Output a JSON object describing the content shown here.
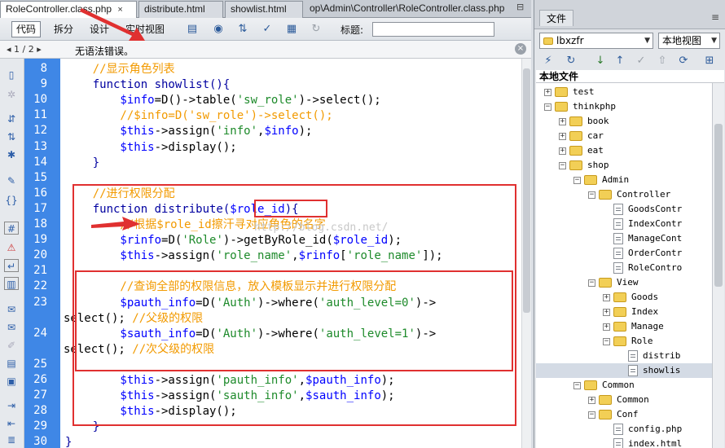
{
  "tabs": [
    {
      "label": "RoleController.class.php"
    },
    {
      "label": "distribute.html"
    },
    {
      "label": "showlist.html"
    },
    {
      "label": "op\\Admin\\Controller\\RoleController.class.php"
    }
  ],
  "tab_close": "×",
  "tab_restore": "⊟",
  "toolbar": {
    "code": "代码",
    "split": "拆分",
    "design": "设计",
    "live_view": "实时视图",
    "title_label": "标题:",
    "title_value": ""
  },
  "infobar": {
    "page_nav": "◂ 1 / 2 ▸",
    "status": "无语法错误。",
    "close": "×"
  },
  "watermark": "http://blog.csdn.net/",
  "code_lines": [
    {
      "n": "8",
      "parts": [
        {
          "t": "    //显示角色列表",
          "c": "cm"
        }
      ]
    },
    {
      "n": "9",
      "parts": [
        {
          "t": "    function showlist(){",
          "c": "kw"
        }
      ]
    },
    {
      "n": "10",
      "parts": [
        {
          "t": "        $info",
          "c": "vr"
        },
        {
          "t": "=D()->table(",
          "c": "op"
        },
        {
          "t": "'sw_role'",
          "c": "st"
        },
        {
          "t": ")->select();",
          "c": "op"
        }
      ]
    },
    {
      "n": "11",
      "parts": [
        {
          "t": "        //$info=D('sw_role')->select();",
          "c": "cm"
        }
      ]
    },
    {
      "n": "12",
      "parts": [
        {
          "t": "        $this",
          "c": "vr"
        },
        {
          "t": "->assign(",
          "c": "op"
        },
        {
          "t": "'info'",
          "c": "st"
        },
        {
          "t": ",",
          "c": "op"
        },
        {
          "t": "$info",
          "c": "vr"
        },
        {
          "t": ");",
          "c": "op"
        }
      ]
    },
    {
      "n": "13",
      "parts": [
        {
          "t": "        $this",
          "c": "vr"
        },
        {
          "t": "->display();",
          "c": "op"
        }
      ]
    },
    {
      "n": "14",
      "parts": [
        {
          "t": "    }",
          "c": "kw"
        }
      ]
    },
    {
      "n": "15",
      "parts": [
        {
          "t": "",
          "c": "op"
        }
      ]
    },
    {
      "n": "16",
      "parts": [
        {
          "t": "    //进行权限分配",
          "c": "cm"
        }
      ]
    },
    {
      "n": "17",
      "parts": [
        {
          "t": "    function distribute(",
          "c": "kw"
        },
        {
          "t": "$role_id",
          "c": "vr"
        },
        {
          "t": "){",
          "c": "kw"
        }
      ]
    },
    {
      "n": "18",
      "parts": [
        {
          "t": "        //根据$role_id擦汗寻对应角色的名字",
          "c": "cm"
        }
      ]
    },
    {
      "n": "19",
      "parts": [
        {
          "t": "        $rinfo",
          "c": "vr"
        },
        {
          "t": "=D(",
          "c": "op"
        },
        {
          "t": "'Role'",
          "c": "st"
        },
        {
          "t": ")->getByRole_id(",
          "c": "op"
        },
        {
          "t": "$role_id",
          "c": "vr"
        },
        {
          "t": ");",
          "c": "op"
        }
      ]
    },
    {
      "n": "20",
      "parts": [
        {
          "t": "        $this",
          "c": "vr"
        },
        {
          "t": "->assign(",
          "c": "op"
        },
        {
          "t": "'role_name'",
          "c": "st"
        },
        {
          "t": ",",
          "c": "op"
        },
        {
          "t": "$rinfo",
          "c": "vr"
        },
        {
          "t": "[",
          "c": "op"
        },
        {
          "t": "'role_name'",
          "c": "st"
        },
        {
          "t": "]);",
          "c": "op"
        }
      ]
    },
    {
      "n": "21",
      "parts": [
        {
          "t": "",
          "c": "op"
        }
      ]
    },
    {
      "n": "22",
      "parts": [
        {
          "t": "        //查询全部的权限信息，放入模板显示并进行权限分配",
          "c": "cm"
        }
      ]
    },
    {
      "n": "23",
      "parts": [
        {
          "t": "        $pauth_info",
          "c": "vr"
        },
        {
          "t": "=D(",
          "c": "op"
        },
        {
          "t": "'Auth'",
          "c": "st"
        },
        {
          "t": ")->where(",
          "c": "op"
        },
        {
          "t": "'auth_level=0'",
          "c": "st"
        },
        {
          "t": ")->",
          "c": "op"
        }
      ]
    },
    {
      "n": "",
      "parts": [
        {
          "t": "select(); ",
          "c": "op"
        },
        {
          "t": "//父级的权限",
          "c": "cm"
        }
      ]
    },
    {
      "n": "24",
      "parts": [
        {
          "t": "        $sauth_info",
          "c": "vr"
        },
        {
          "t": "=D(",
          "c": "op"
        },
        {
          "t": "'Auth'",
          "c": "st"
        },
        {
          "t": ")->where(",
          "c": "op"
        },
        {
          "t": "'auth_level=1'",
          "c": "st"
        },
        {
          "t": ")->",
          "c": "op"
        }
      ]
    },
    {
      "n": "",
      "parts": [
        {
          "t": "select(); ",
          "c": "op"
        },
        {
          "t": "//次父级的权限",
          "c": "cm"
        }
      ]
    },
    {
      "n": "25",
      "parts": [
        {
          "t": "",
          "c": "op"
        }
      ]
    },
    {
      "n": "26",
      "parts": [
        {
          "t": "        $this",
          "c": "vr"
        },
        {
          "t": "->assign(",
          "c": "op"
        },
        {
          "t": "'pauth_info'",
          "c": "st"
        },
        {
          "t": ",",
          "c": "op"
        },
        {
          "t": "$pauth_info",
          "c": "vr"
        },
        {
          "t": ");",
          "c": "op"
        }
      ]
    },
    {
      "n": "27",
      "parts": [
        {
          "t": "        $this",
          "c": "vr"
        },
        {
          "t": "->assign(",
          "c": "op"
        },
        {
          "t": "'sauth_info'",
          "c": "st"
        },
        {
          "t": ",",
          "c": "op"
        },
        {
          "t": "$sauth_info",
          "c": "vr"
        },
        {
          "t": ");",
          "c": "op"
        }
      ]
    },
    {
      "n": "28",
      "parts": [
        {
          "t": "        $this",
          "c": "vr"
        },
        {
          "t": "->display();",
          "c": "op"
        }
      ]
    },
    {
      "n": "29",
      "parts": [
        {
          "t": "    }",
          "c": "kw"
        }
      ]
    },
    {
      "n": "30",
      "parts": [
        {
          "t": "}",
          "c": "kw"
        }
      ]
    }
  ],
  "files_panel": {
    "tab": "文件",
    "menu": "≡",
    "site": "lbxzfr",
    "view": "本地视图",
    "tree_header": "本地文件",
    "tree": [
      {
        "label": "test",
        "type": "folder",
        "depth": 1,
        "exp": "+"
      },
      {
        "label": "thinkphp",
        "type": "folder",
        "depth": 1,
        "exp": "−"
      },
      {
        "label": "book",
        "type": "folder",
        "depth": 2,
        "exp": "+"
      },
      {
        "label": "car",
        "type": "folder",
        "depth": 2,
        "exp": "+"
      },
      {
        "label": "eat",
        "type": "folder",
        "depth": 2,
        "exp": "+"
      },
      {
        "label": "shop",
        "type": "folder",
        "depth": 2,
        "exp": "−"
      },
      {
        "label": "Admin",
        "type": "folder",
        "depth": 3,
        "exp": "−"
      },
      {
        "label": "Controller",
        "type": "folder",
        "depth": 4,
        "exp": "−"
      },
      {
        "label": "GoodsContr",
        "type": "file",
        "depth": 5,
        "exp": ""
      },
      {
        "label": "IndexContr",
        "type": "file",
        "depth": 5,
        "exp": ""
      },
      {
        "label": "ManageCont",
        "type": "file",
        "depth": 5,
        "exp": ""
      },
      {
        "label": "OrderContr",
        "type": "file",
        "depth": 5,
        "exp": ""
      },
      {
        "label": "RoleContro",
        "type": "file",
        "depth": 5,
        "exp": ""
      },
      {
        "label": "View",
        "type": "folder",
        "depth": 4,
        "exp": "−"
      },
      {
        "label": "Goods",
        "type": "folder",
        "depth": 5,
        "exp": "+"
      },
      {
        "label": "Index",
        "type": "folder",
        "depth": 5,
        "exp": "+"
      },
      {
        "label": "Manage",
        "type": "folder",
        "depth": 5,
        "exp": "+"
      },
      {
        "label": "Role",
        "type": "folder",
        "depth": 5,
        "exp": "−"
      },
      {
        "label": "distrib",
        "type": "file",
        "depth": 6,
        "exp": ""
      },
      {
        "label": "showlis",
        "type": "file",
        "depth": 6,
        "exp": "",
        "selected": true
      },
      {
        "label": "Common",
        "type": "folder",
        "depth": 3,
        "exp": "−"
      },
      {
        "label": "Common",
        "type": "folder",
        "depth": 4,
        "exp": "+"
      },
      {
        "label": "Conf",
        "type": "folder",
        "depth": 4,
        "exp": "−"
      },
      {
        "label": "config.php",
        "type": "file",
        "depth": 5,
        "exp": ""
      },
      {
        "label": "index.html",
        "type": "file",
        "depth": 5,
        "exp": ""
      }
    ]
  },
  "colors": {
    "gutter": "#3f87e6",
    "annotation": "#e03030",
    "keyword": "#0000a0",
    "comment": "#f29a00",
    "string": "#1d8a2a",
    "variable": "#0000ff"
  }
}
